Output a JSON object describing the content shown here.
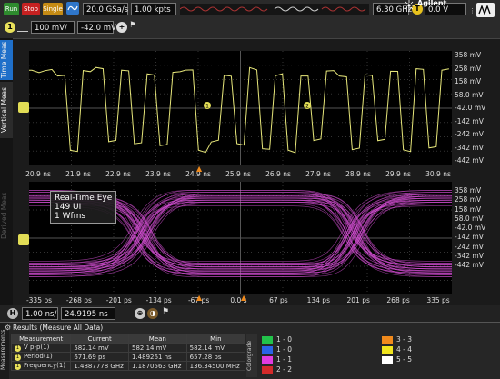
{
  "toolbar": {
    "run_label": "Run",
    "stop_label": "Stop",
    "single_label": "Single",
    "sample_rate": "20.0 GSa/s",
    "memory_depth": "1.00 kpts",
    "bandwidth": "6.30 GHz",
    "trigger_badge": "T",
    "trigger_level": "0.0 V",
    "brand": "Agilent"
  },
  "channel": {
    "badge": "1",
    "scale": "100 mV/",
    "offset": "-42.0 mV"
  },
  "left_tabs": [
    "Time Meas",
    "Vertical Meas",
    "Derived Meas"
  ],
  "top_plot": {
    "y_ticks": [
      "358 mV",
      "258 mV",
      "158 mV",
      "58.0 mV",
      "-42.0 mV",
      "-142 mV",
      "-242 mV",
      "-342 mV",
      "-442 mV"
    ],
    "x_ticks": [
      "20.9 ns",
      "21.9 ns",
      "22.9 ns",
      "23.9 ns",
      "24.9 ns",
      "25.9 ns",
      "26.9 ns",
      "27.9 ns",
      "28.9 ns",
      "29.9 ns",
      "30.9 ns"
    ],
    "markers": [
      "1",
      "2"
    ]
  },
  "eye_plot": {
    "legend_title": "Real-Time Eye",
    "legend_ui": "149 UI",
    "legend_wfms": "1 Wfms",
    "y_ticks": [
      "358 mV",
      "258 mV",
      "158 mV",
      "58.0 mV",
      "-42.0 mV",
      "-142 mV",
      "-242 mV",
      "-342 mV",
      "-442 mV"
    ],
    "x_ticks": [
      "-335 ps",
      "-268 ps",
      "-201 ps",
      "-134 ps",
      "-67 ps",
      "0.0 s",
      "67 ps",
      "134 ps",
      "201 ps",
      "268 ps",
      "335 ps"
    ]
  },
  "timebase": {
    "badge": "H",
    "scale": "1.00 ns/",
    "position": "24.9195 ns"
  },
  "results": {
    "header": "Results   (Measure All Data)",
    "side_label": "Measurements",
    "columns": [
      "Measurement",
      "Current",
      "Mean",
      "Min"
    ],
    "rows": [
      [
        "V p-p(1)",
        "582.14 mV",
        "582.14 mV",
        "582.14 mV"
      ],
      [
        "Period(1)",
        "671.69 ps",
        "1.489261 ns",
        "657.28 ps"
      ],
      [
        "Frequency(1)",
        "1.4887778 GHz",
        "1.1870563 GHz",
        "136.34500 MHz"
      ]
    ],
    "colorgrade_label": "Colorgrade",
    "colorgrade": [
      {
        "label": "1 - 0",
        "color": "#22c24a"
      },
      {
        "label": "1 - 0",
        "color": "#2a63e6"
      },
      {
        "label": "1 - 1",
        "color": "#e13be0"
      },
      {
        "label": "2 - 2",
        "color": "#d42a2a"
      },
      {
        "label": "3 - 3",
        "color": "#f08a1c"
      },
      {
        "label": "4 - 4",
        "color": "#f0e41e"
      },
      {
        "label": "5 - 5",
        "color": "#ffffff"
      }
    ]
  },
  "colors": {
    "channel1": "#e6e67a",
    "eye": "#d34fd3"
  }
}
